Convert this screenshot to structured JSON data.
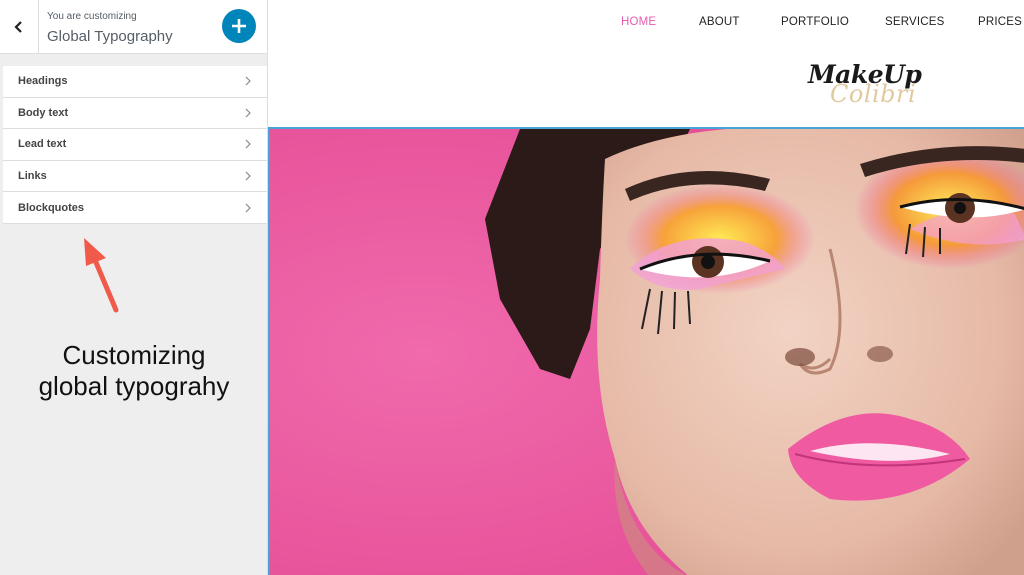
{
  "sidebar": {
    "header": {
      "subtitle": "You are customizing",
      "title": "Global Typography",
      "back_icon": "chevron-left-icon",
      "add_icon": "plus-icon"
    },
    "items": [
      {
        "label": "Headings"
      },
      {
        "label": "Body text"
      },
      {
        "label": "Lead text"
      },
      {
        "label": "Links"
      },
      {
        "label": "Blockquotes"
      }
    ],
    "annotation": {
      "line1": "Customizing",
      "line2": "global typograhy"
    }
  },
  "preview": {
    "nav": [
      {
        "label": "HOME",
        "active": true
      },
      {
        "label": "ABOUT"
      },
      {
        "label": "PORTFOLIO"
      },
      {
        "label": "SERVICES"
      },
      {
        "label": "PRICES"
      }
    ],
    "logo": {
      "line1": "MakeUp",
      "line2": "Colibri"
    }
  },
  "colors": {
    "accent": "#0085ba",
    "nav_active": "#e45caf",
    "hero_pink": "#e84ea0",
    "annotation_arrow": "#f05a4a",
    "selection_border": "#47a3d6"
  }
}
